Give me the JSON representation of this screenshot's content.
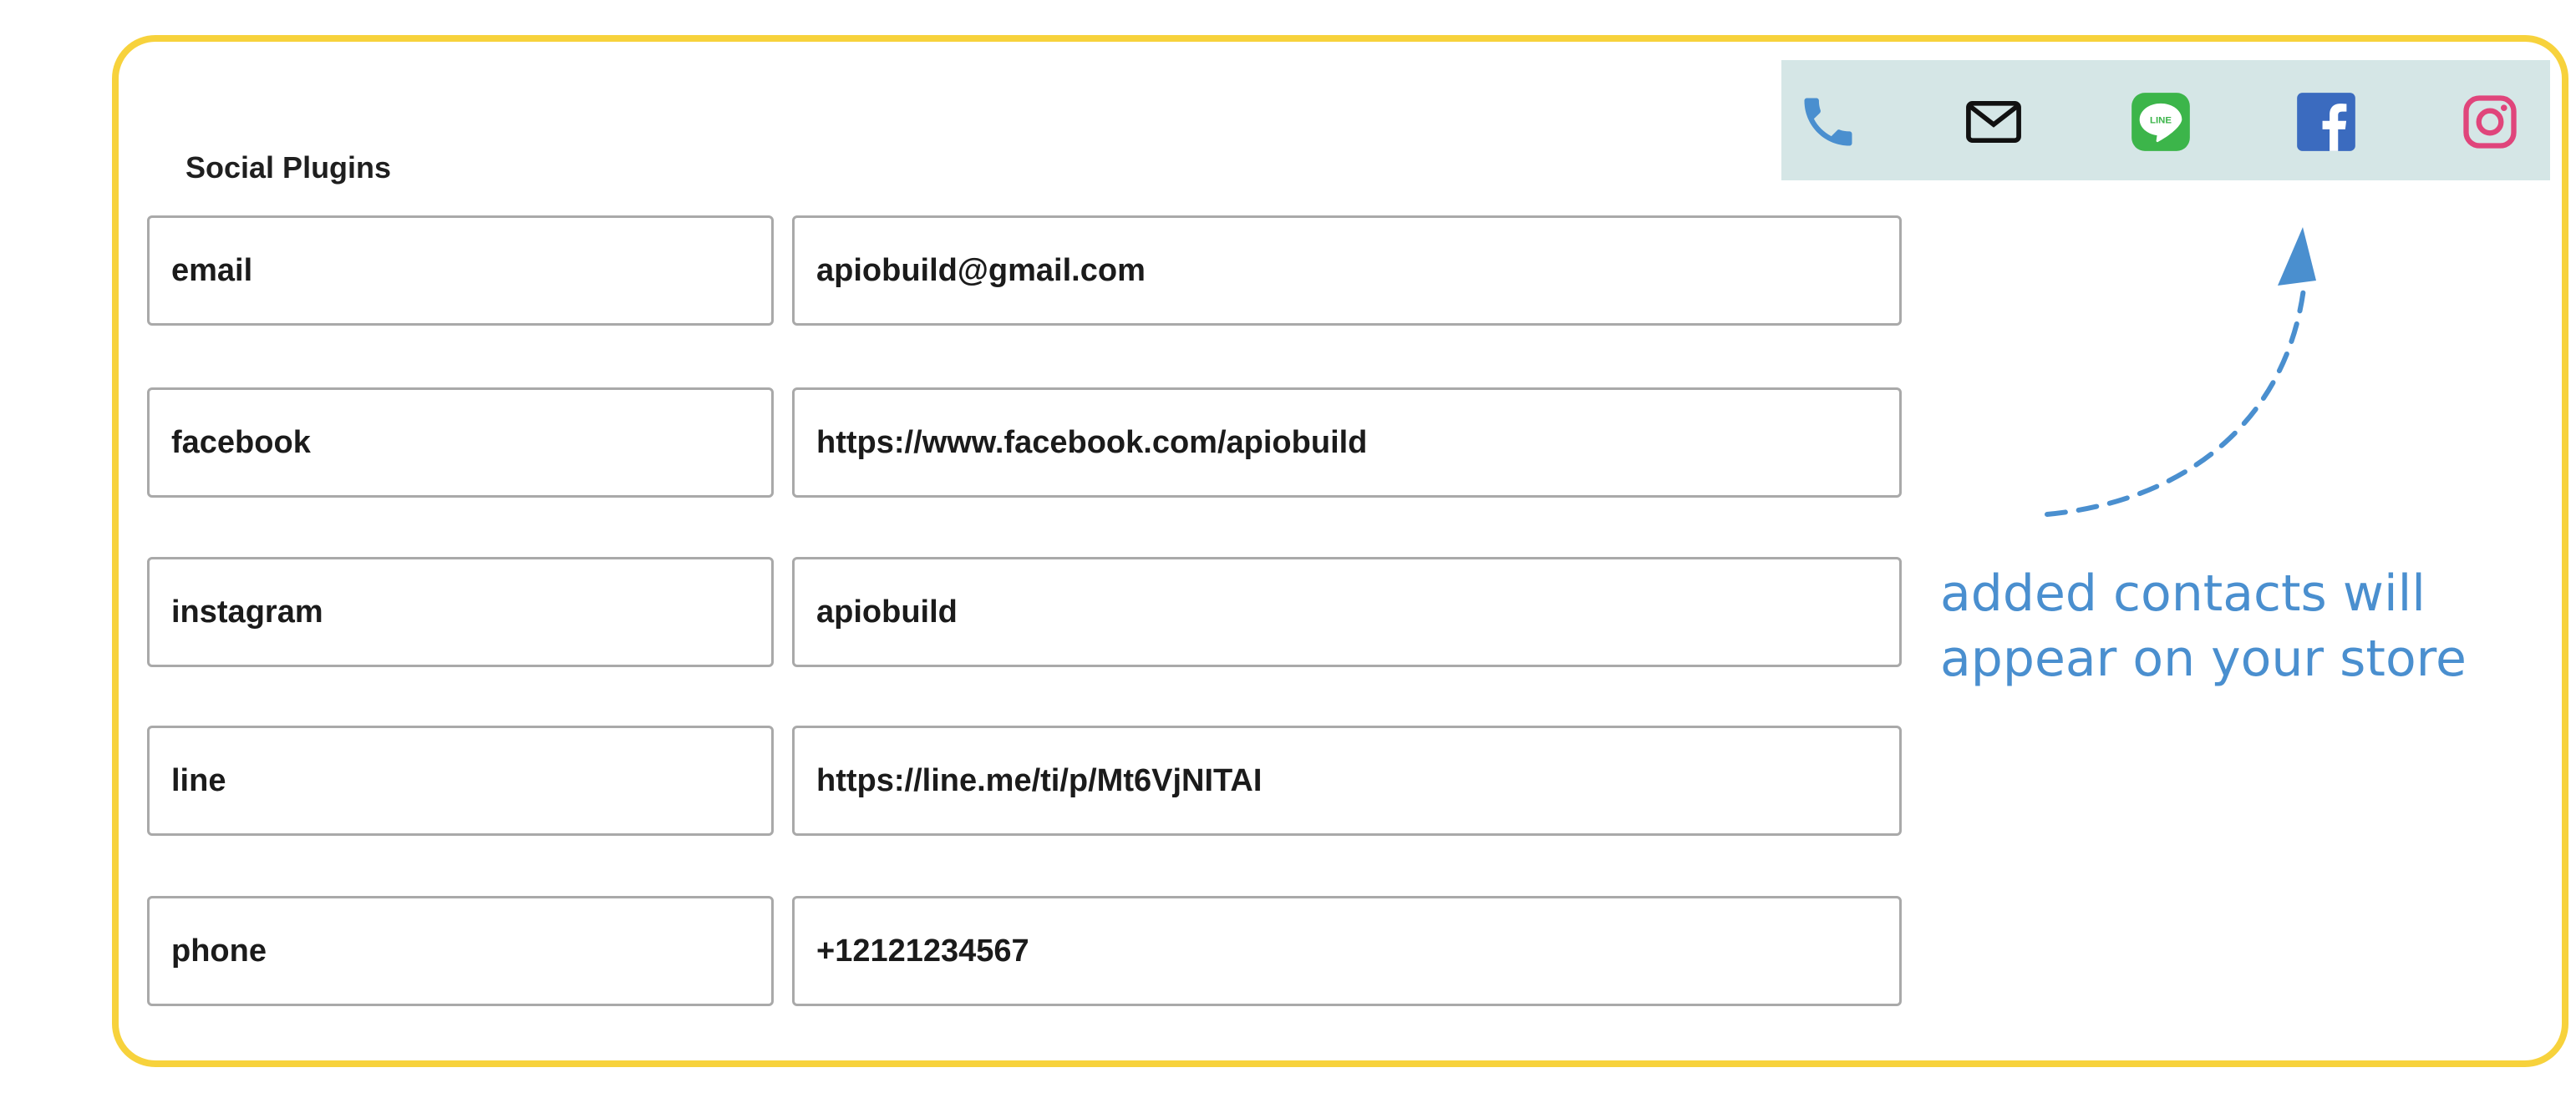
{
  "section": {
    "title": "Social Plugins"
  },
  "contacts": [
    {
      "key": "email",
      "value": "apiobuild@gmail.com"
    },
    {
      "key": "facebook",
      "value": "https://www.facebook.com/apiobuild"
    },
    {
      "key": "instagram",
      "value": "apiobuild"
    },
    {
      "key": "line",
      "value": "https://line.me/ti/p/Mt6VjNITAI"
    },
    {
      "key": "phone",
      "value": "+12121234567"
    }
  ],
  "icon_bar": {
    "icons": [
      "phone-icon",
      "mail-icon",
      "line-icon",
      "facebook-icon",
      "instagram-icon"
    ],
    "line_badge_text": "LINE"
  },
  "note": {
    "line1": "added contacts will",
    "line2": "appear on your store"
  },
  "colors": {
    "frame": "#f7d23c",
    "icon_bar_bg": "#d5e6e6",
    "annotation": "#4a8fcf",
    "phone": "#4a8fcf",
    "line": "#3cb54a",
    "facebook": "#3b6bbf",
    "instagram": "#e0457b"
  }
}
